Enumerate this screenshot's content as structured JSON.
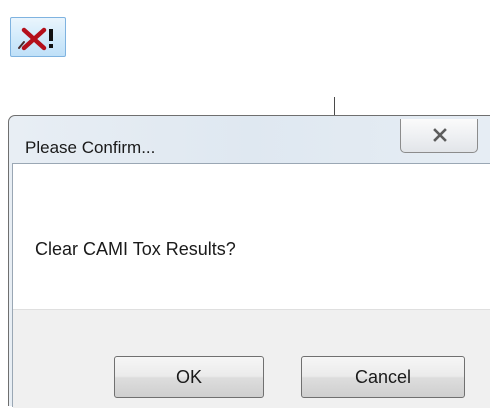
{
  "toolbar": {
    "clear_results_icon": "clear-results-icon"
  },
  "dialog": {
    "title": "Please Confirm...",
    "message": "Clear CAMI Tox Results?",
    "ok_label": "OK",
    "cancel_label": "Cancel",
    "close_icon": "close-icon"
  },
  "colors": {
    "icon_x": "#b4101b",
    "icon_bg": "#cfe7fa",
    "dialog_frame": "#dfe8f1",
    "footer": "#f0f0f0"
  }
}
